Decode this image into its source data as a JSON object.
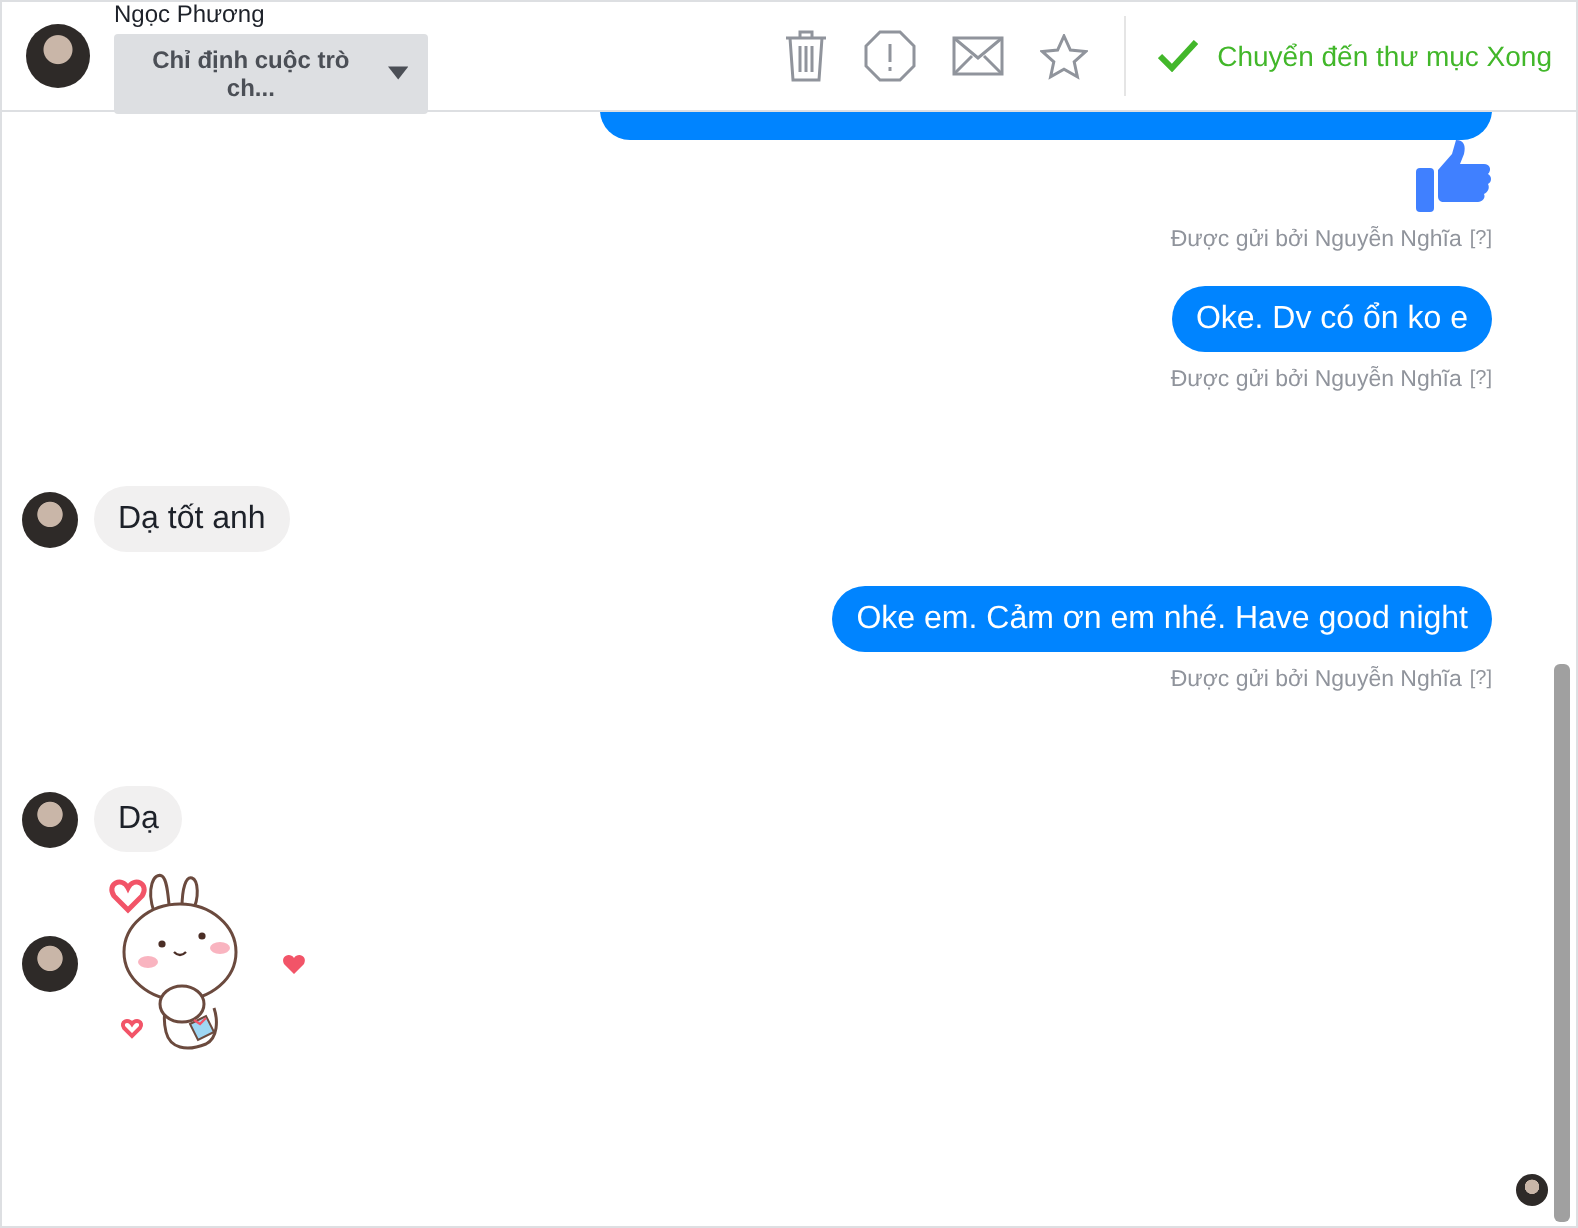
{
  "header": {
    "contact_name": "Ngọc Phương",
    "assign_dropdown": "Chỉ định cuộc trò ch...",
    "move_done": "Chuyển đến thư mục Xong"
  },
  "messages": [
    {
      "kind": "outgoing_cut"
    },
    {
      "kind": "like",
      "sent_by": "Được gửi bởi Nguyễn Nghĩa",
      "help": "[?]"
    },
    {
      "kind": "outgoing",
      "text": "Oke. Dv có ổn ko e",
      "sent_by": "Được gửi bởi Nguyễn Nghĩa",
      "help": "[?]"
    },
    {
      "kind": "incoming",
      "text": "Dạ tốt anh"
    },
    {
      "kind": "outgoing",
      "text": "Oke em. Cảm ơn em nhé. Have good night",
      "sent_by": "Được gửi bởi Nguyễn Nghĩa",
      "help": "[?]"
    },
    {
      "kind": "incoming",
      "text": "Dạ"
    },
    {
      "kind": "sticker"
    }
  ]
}
